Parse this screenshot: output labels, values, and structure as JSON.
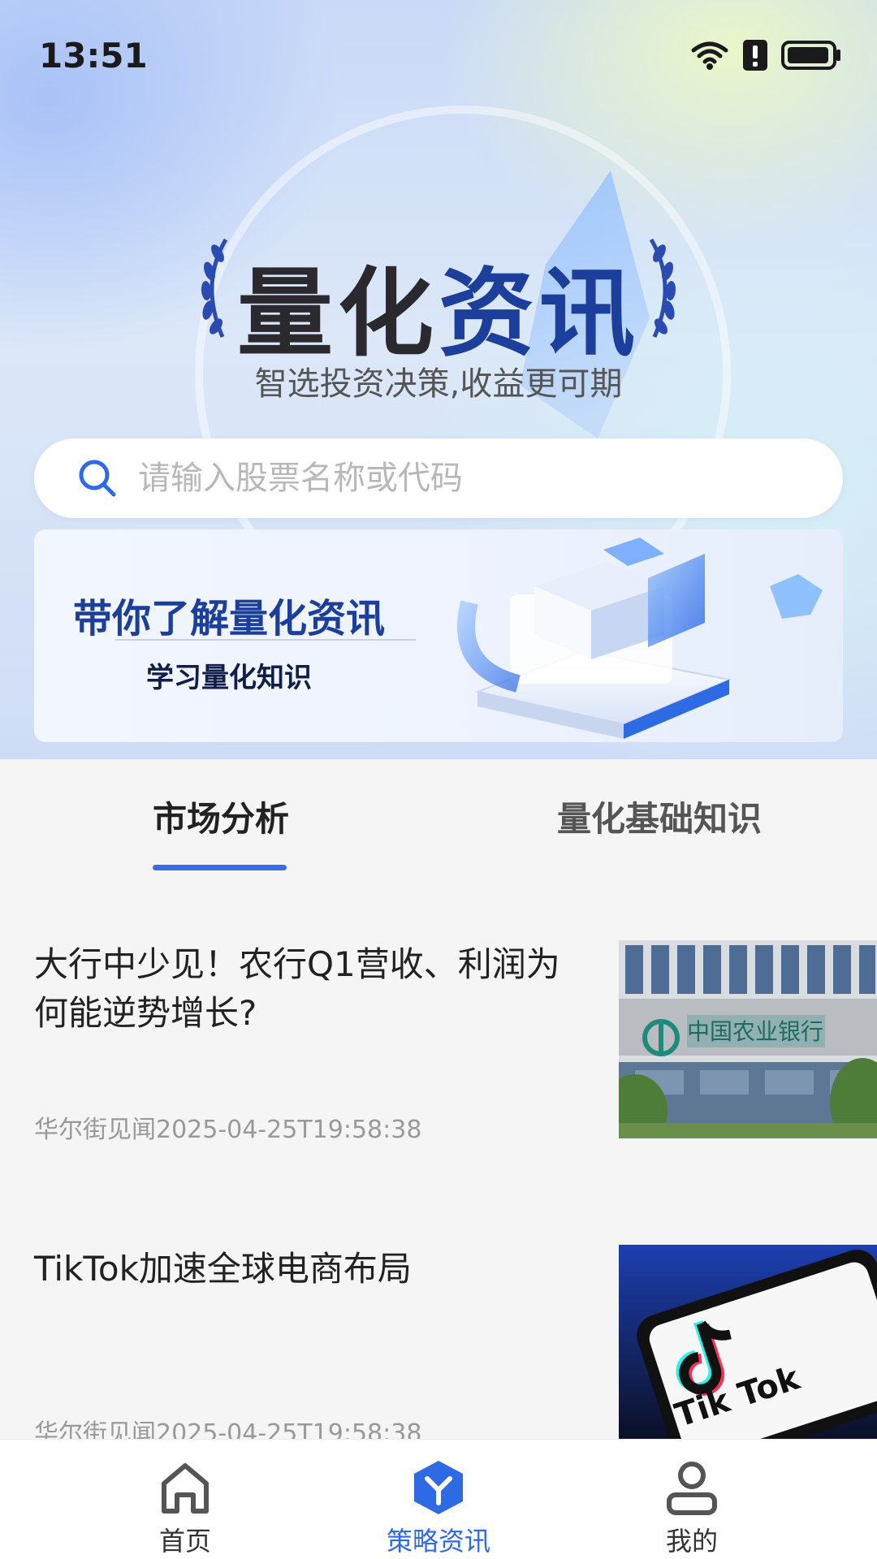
{
  "status": {
    "time": "13:51"
  },
  "hero": {
    "title_part1": "量化",
    "title_part2": "资讯",
    "subtitle": "智选投资决策,收益更可期"
  },
  "search": {
    "placeholder": "请输入股票名称或代码"
  },
  "banner": {
    "title": "带你了解量化资讯",
    "subtitle": "学习量化知识"
  },
  "tabs": [
    {
      "label": "市场分析",
      "active": true
    },
    {
      "label": "量化基础知识",
      "active": false
    }
  ],
  "news": [
    {
      "title": "大行中少见！农行Q1营收、利润为何能逆势增长?",
      "meta": "华尔街见闻2025-04-25T19:58:38",
      "thumb": "中国农业银行"
    },
    {
      "title": "TikTok加速全球电商布局",
      "meta": "华尔街见闻2025-04-25T19:58:38",
      "thumb": "Tik Tok"
    }
  ],
  "nav": [
    {
      "label": "首页",
      "icon": "home-icon",
      "active": false
    },
    {
      "label": "策略资讯",
      "icon": "strategy-icon",
      "active": true
    },
    {
      "label": "我的",
      "icon": "profile-icon",
      "active": false
    }
  ],
  "colors": {
    "accent": "#2f6ae5",
    "title_blue": "#1d3f9c",
    "tab_underline": "#3a6be8"
  }
}
